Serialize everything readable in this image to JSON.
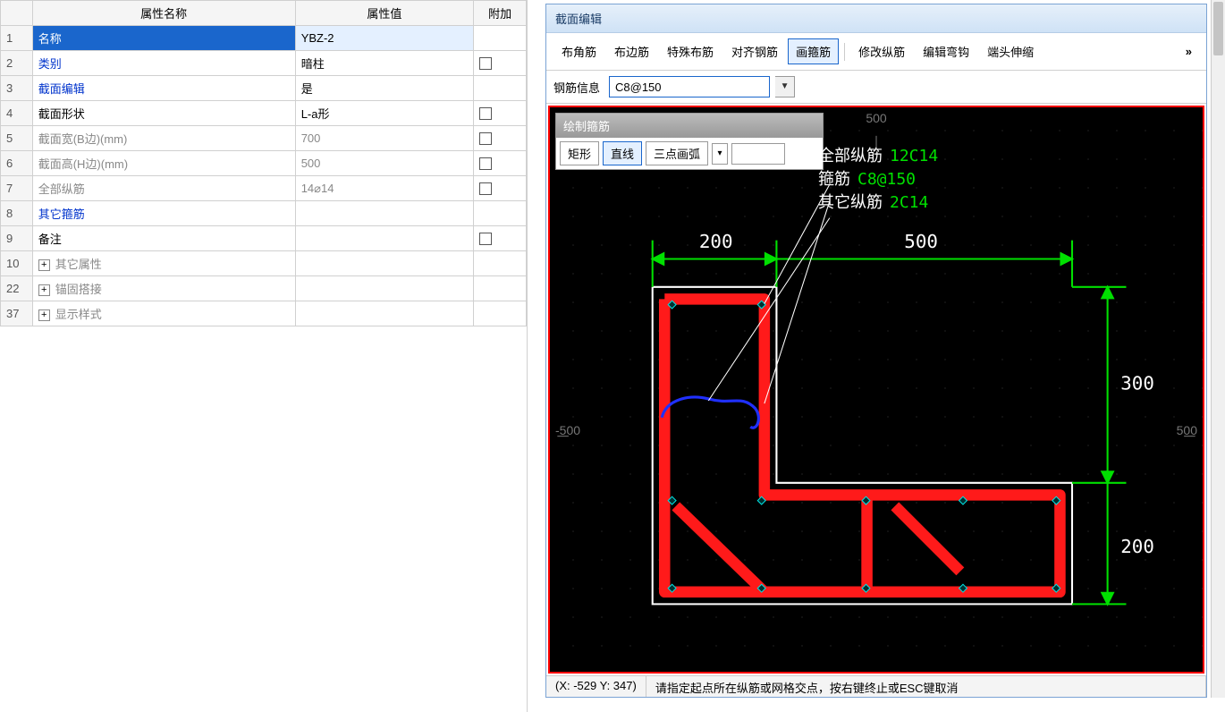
{
  "propgrid": {
    "headers": {
      "name": "属性名称",
      "value": "属性值",
      "extra": "附加"
    },
    "rows": [
      {
        "num": "1",
        "name": "名称",
        "value": "YBZ-2",
        "selected": true
      },
      {
        "num": "2",
        "name": "类别",
        "value": "暗柱",
        "link": true,
        "chk": true
      },
      {
        "num": "3",
        "name": "截面编辑",
        "value": "是",
        "link": true
      },
      {
        "num": "4",
        "name": "截面形状",
        "value": "L-a形",
        "chk": true
      },
      {
        "num": "5",
        "name": "截面宽(B边)(mm)",
        "value": "700",
        "dim": true,
        "chk": true
      },
      {
        "num": "6",
        "name": "截面高(H边)(mm)",
        "value": "500",
        "dim": true,
        "chk": true
      },
      {
        "num": "7",
        "name": "全部纵筋",
        "value": "14⌀14",
        "dim": true,
        "chk": true
      },
      {
        "num": "8",
        "name": "其它箍筋",
        "value": "",
        "link": true
      },
      {
        "num": "9",
        "name": "备注",
        "value": "",
        "chk": true
      },
      {
        "num": "10",
        "name": "其它属性",
        "value": "",
        "dim": true,
        "tree": true
      },
      {
        "num": "22",
        "name": "锚固搭接",
        "value": "",
        "dim": true,
        "tree": true
      },
      {
        "num": "37",
        "name": "显示样式",
        "value": "",
        "dim": true,
        "tree": true
      }
    ]
  },
  "section_editor": {
    "title": "截面编辑",
    "toolbar": {
      "items": [
        "布角筋",
        "布边筋",
        "特殊布筋",
        "对齐钢筋",
        "画箍筋",
        "修改纵筋",
        "编辑弯钩",
        "端头伸缩"
      ],
      "active_index": 4,
      "more": "»"
    },
    "info": {
      "label": "钢筋信息",
      "value": "C8@150"
    },
    "draw_palette": {
      "title": "绘制箍筋",
      "buttons": [
        "矩形",
        "直线",
        "三点画弧"
      ],
      "active_index": 1
    },
    "legend": [
      {
        "label": "全部纵筋",
        "value": "12C14"
      },
      {
        "label": "箍筋",
        "value": "C8@150"
      },
      {
        "label": "其它纵筋",
        "value": "2C14"
      }
    ],
    "axis_ticks": {
      "x_neg": "-500",
      "x_pos": "500",
      "y_pos": "500"
    },
    "dims": {
      "top_left": "200",
      "top_right": "500",
      "right_top": "300",
      "right_bottom": "200"
    },
    "status": {
      "coords": "(X: -529 Y: 347)",
      "msg": "请指定起点所在纵筋或网格交点，按右键终止或ESC键取消"
    }
  }
}
